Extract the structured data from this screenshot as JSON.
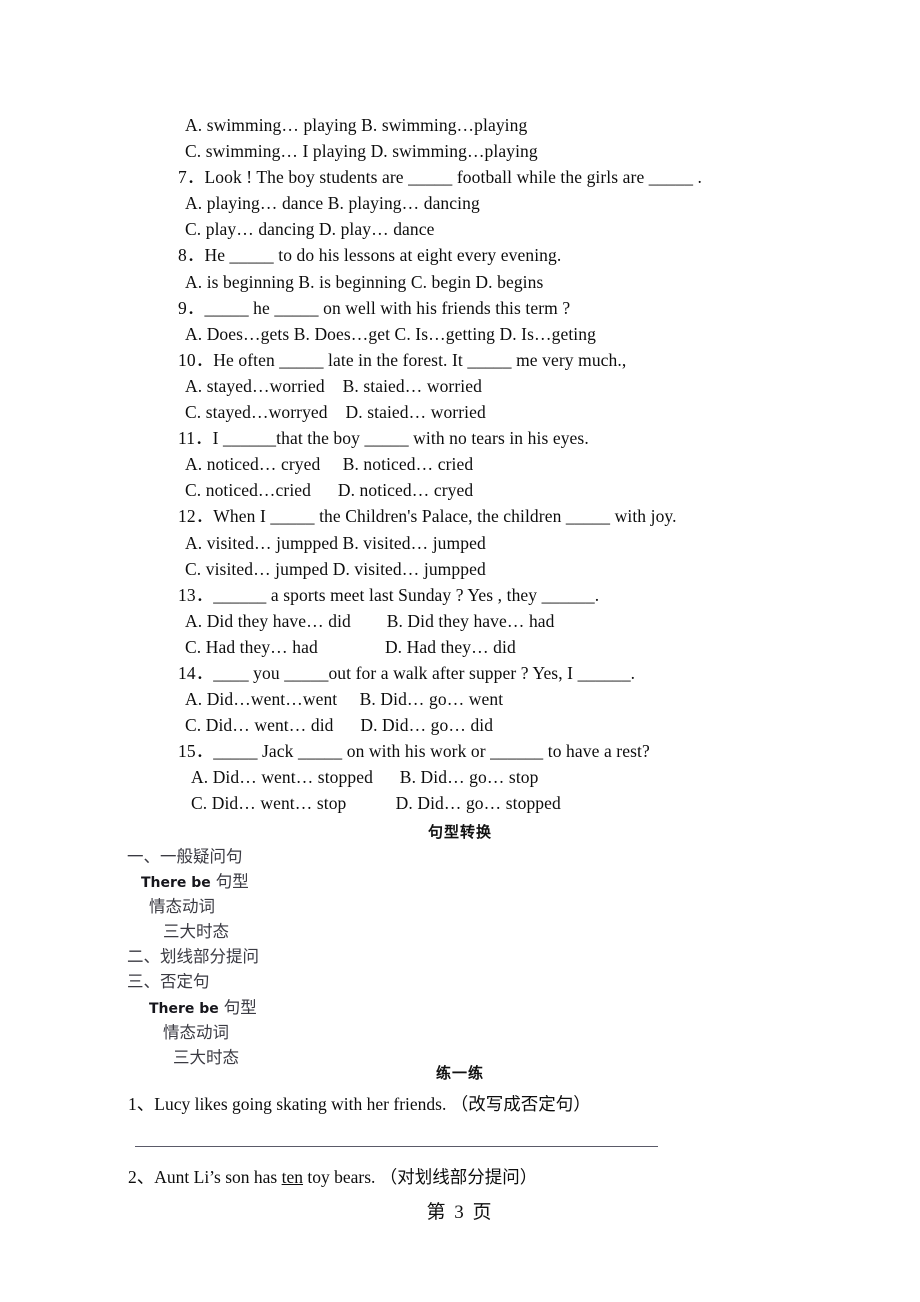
{
  "document": {
    "page_footer": "第 3 页"
  },
  "multiple_choice": {
    "lines": [
      {
        "text": "A. swimming… playing B. swimming…playing",
        "indent": 1
      },
      {
        "text": "C. swimming… I playing D. swimming…playing",
        "indent": 1
      },
      {
        "text": "7．Look ! The boy students are _____ football while the girls are _____ .",
        "indent": 0
      },
      {
        "text": "A. playing… dance B. playing… dancing",
        "indent": 1
      },
      {
        "text": "C. play… dancing D. play… dance",
        "indent": 1
      },
      {
        "text": "8．He _____ to do his lessons at eight every evening.",
        "indent": 0
      },
      {
        "text": "A. is beginning B. is beginning C. begin D. begins",
        "indent": 1
      },
      {
        "text": "9．_____ he _____ on well with his friends this term ?",
        "indent": 0
      },
      {
        "text": "A. Does…gets B. Does…get C. Is…getting D. Is…geting",
        "indent": 1
      },
      {
        "text": "10．He often _____ late in the forest. It _____ me very much.,",
        "indent": 0
      },
      {
        "text": "A. stayed…worried    B. staied… worried",
        "indent": 1
      },
      {
        "text": "C. stayed…worryed    D. staied… worried",
        "indent": 1
      },
      {
        "text": "11．I ______that the boy _____ with no tears in his eyes.",
        "indent": 0
      },
      {
        "text": "A. noticed… cryed     B. noticed… cried",
        "indent": 1
      },
      {
        "text": "C. noticed…cried      D. noticed… cryed",
        "indent": 1
      },
      {
        "text": "12．When I _____ the Children's Palace, the children _____ with joy.",
        "indent": 0
      },
      {
        "text": "A. visited… jumpped B. visited… jumped",
        "indent": 1
      },
      {
        "text": "C. visited… jumped D. visited… jumpped",
        "indent": 1
      },
      {
        "text": "13．______ a sports meet last Sunday ? Yes , they ______.",
        "indent": 0
      },
      {
        "text": "A. Did they have… did        B. Did they have… had",
        "indent": 1
      },
      {
        "text": "C. Had they… had               D. Had they… did",
        "indent": 1
      },
      {
        "text": "14．____ you _____out for a walk after supper ? Yes, I ______.",
        "indent": 0
      },
      {
        "text": "A. Did…went…went     B. Did… go… went",
        "indent": 1
      },
      {
        "text": "C. Did… went… did      D. Did… go… did",
        "indent": 1
      },
      {
        "text": "15．_____ Jack _____ on with his work or ______ to have a rest?",
        "indent": 0
      },
      {
        "text": "A. Did… went… stopped      B. Did… go… stop",
        "indent": 2
      },
      {
        "text": "C. Did… went… stop           D. Did… go… stopped",
        "indent": 2
      }
    ]
  },
  "section_juxing": {
    "heading": "句型转换",
    "outline": [
      {
        "zh": "一、一般疑问句",
        "en": "",
        "level": 0
      },
      {
        "zh": "句型",
        "en": "There be ",
        "level": 1
      },
      {
        "zh": "情态动词",
        "en": "",
        "level": 2
      },
      {
        "zh": "三大时态",
        "en": "",
        "level": 3
      },
      {
        "zh": "二、划线部分提问",
        "en": "",
        "level": 0
      },
      {
        "zh": "三、否定句",
        "en": "",
        "level": 0
      },
      {
        "zh": "句型",
        "en": "There be ",
        "level": 2
      },
      {
        "zh": "情态动词",
        "en": "",
        "level": 3
      },
      {
        "zh": "三大时态",
        "en": "",
        "level": 4
      }
    ]
  },
  "section_lianyilian": {
    "heading": "练一练",
    "questions": [
      {
        "number": "1、",
        "before": "Lucy likes going skating with her friends. ",
        "underlined": "",
        "after": "（改写成否定句）"
      },
      {
        "number": "2、",
        "before": "Aunt Li’s son has ",
        "underlined": "ten",
        "after": " toy bears. （对划线部分提问）"
      }
    ]
  }
}
